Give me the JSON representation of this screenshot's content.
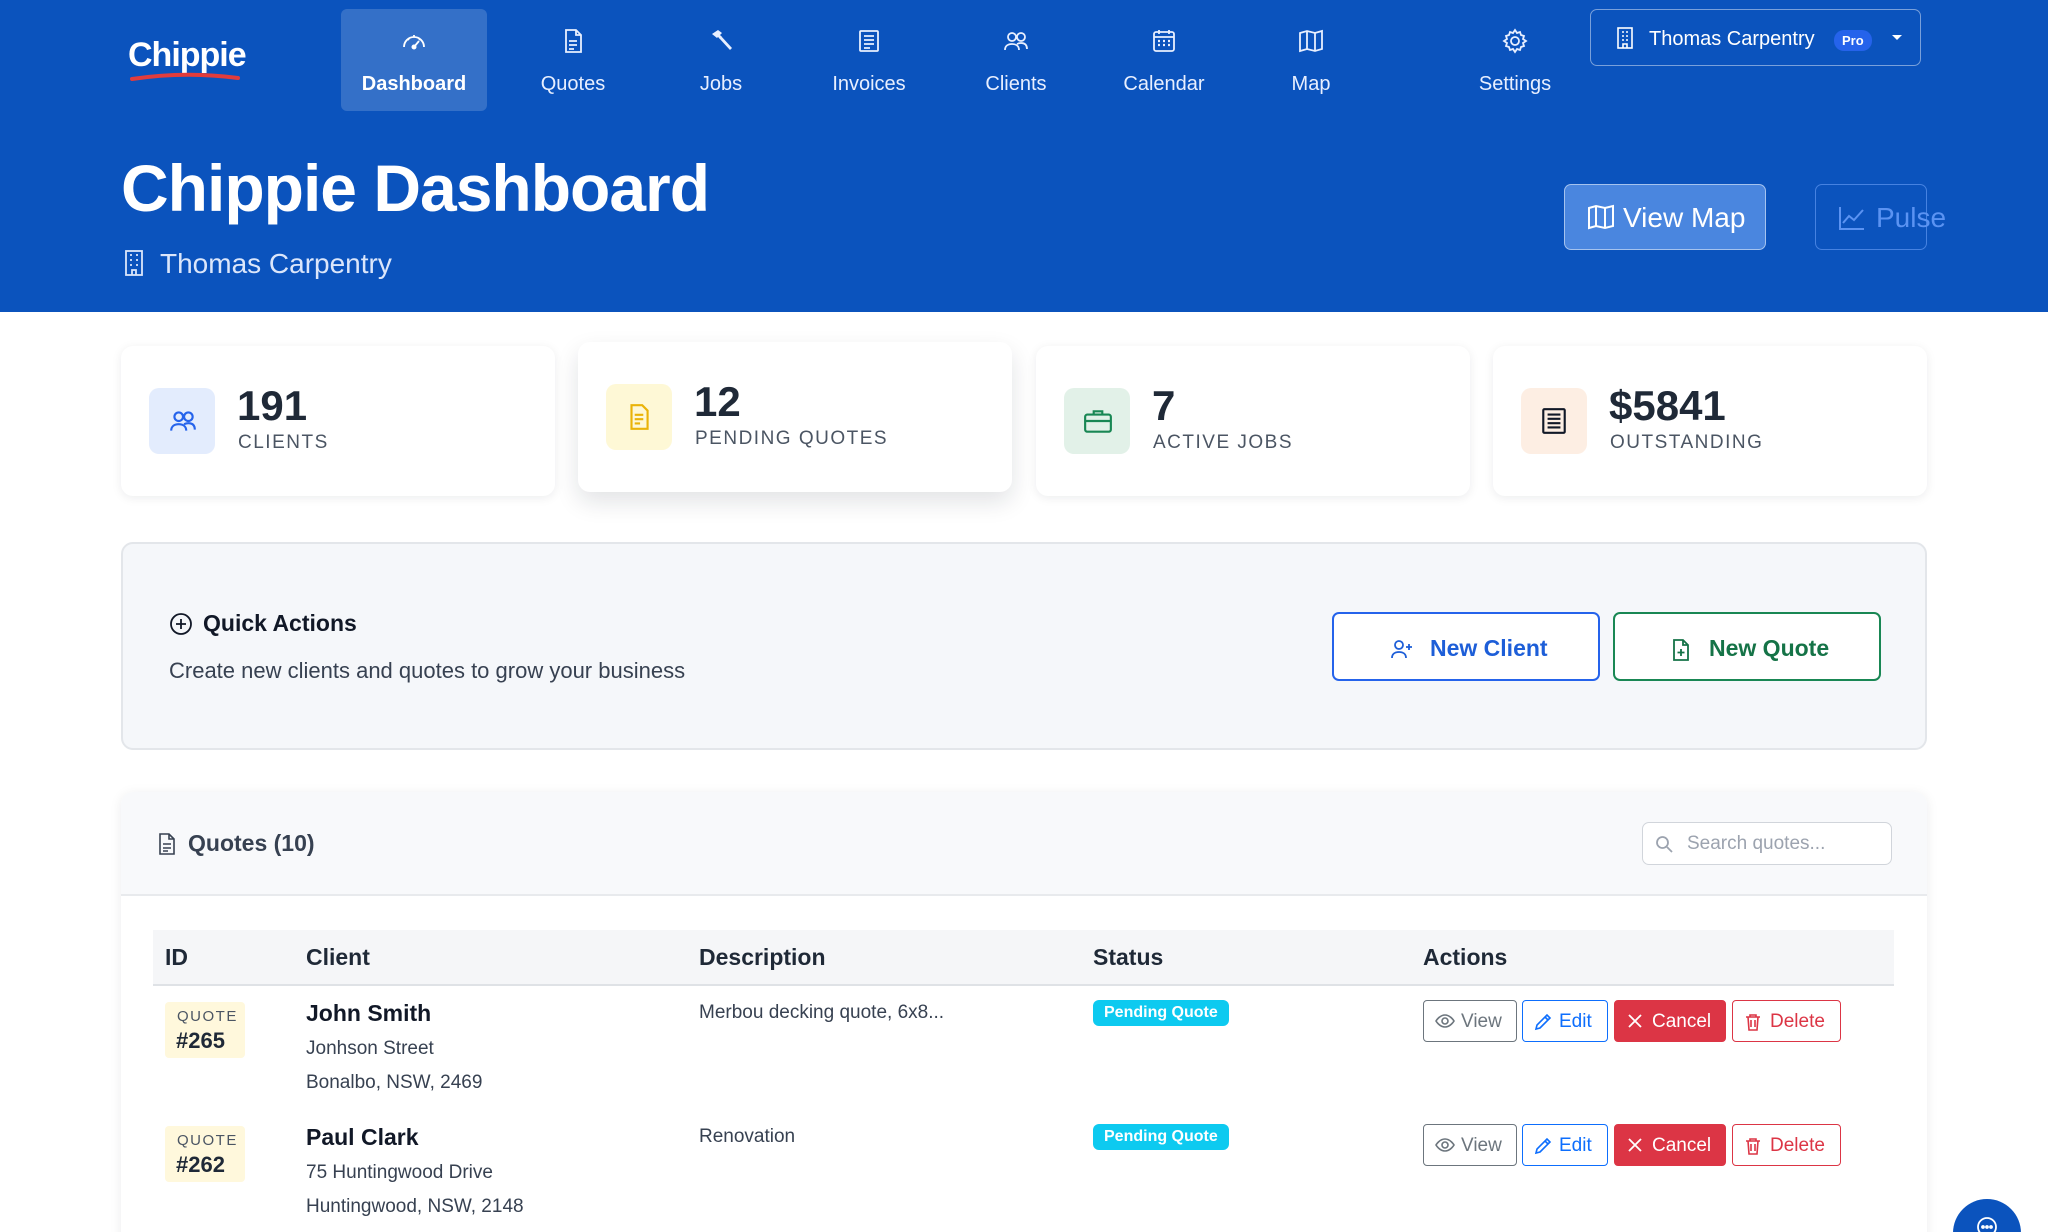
{
  "nav": {
    "logo": "Chippie",
    "items": [
      {
        "label": "Dashboard",
        "icon": "speedometer-icon",
        "active": true
      },
      {
        "label": "Quotes",
        "icon": "document-icon"
      },
      {
        "label": "Jobs",
        "icon": "hammer-icon"
      },
      {
        "label": "Invoices",
        "icon": "receipt-icon"
      },
      {
        "label": "Clients",
        "icon": "people-icon"
      },
      {
        "label": "Calendar",
        "icon": "calendar-icon"
      },
      {
        "label": "Map",
        "icon": "map-icon"
      },
      {
        "label": "Settings",
        "icon": "gear-icon"
      }
    ],
    "account": {
      "name": "Thomas Carpentry",
      "plan": "Pro"
    }
  },
  "header": {
    "title": "Chippie Dashboard",
    "business": "Thomas Carpentry",
    "view_map_label": "View Map",
    "pulse_label": "Pulse"
  },
  "stats": [
    {
      "value": "191",
      "label": "CLIENTS",
      "icon": "people-icon",
      "color": "#2563eb"
    },
    {
      "value": "12",
      "label": "PENDING QUOTES",
      "icon": "document-icon",
      "color": "#eab308"
    },
    {
      "value": "7",
      "label": "ACTIVE JOBS",
      "icon": "briefcase-icon",
      "color": "#198754"
    },
    {
      "value": "$5841",
      "label": "OUTSTANDING",
      "icon": "receipt-icon",
      "color": "#111827"
    }
  ],
  "quick_actions": {
    "title": "Quick Actions",
    "subtitle": "Create new clients and quotes to grow your business",
    "new_client_label": "New Client",
    "new_quote_label": "New Quote"
  },
  "quotes": {
    "title": "Quotes (10)",
    "search_placeholder": "Search quotes...",
    "columns": [
      "ID",
      "Client",
      "Description",
      "Status",
      "Actions"
    ],
    "action_labels": {
      "view": "View",
      "edit": "Edit",
      "cancel": "Cancel",
      "delete": "Delete"
    },
    "rows": [
      {
        "id_label": "QUOTE",
        "id": "#265",
        "client": "John Smith",
        "address1": "Jonhson Street",
        "address2": "Bonalbo, NSW, 2469",
        "description": "Merbou decking quote, 6x8...",
        "status": "Pending Quote"
      },
      {
        "id_label": "QUOTE",
        "id": "#262",
        "client": "Paul Clark",
        "address1": "75 Huntingwood Drive",
        "address2": "Huntingwood, NSW, 2148",
        "description": "Renovation",
        "status": "Pending Quote"
      }
    ]
  },
  "colors": {
    "brand": "#0b53bd",
    "status_pending": "#0dcaf0",
    "danger": "#dc3545"
  }
}
